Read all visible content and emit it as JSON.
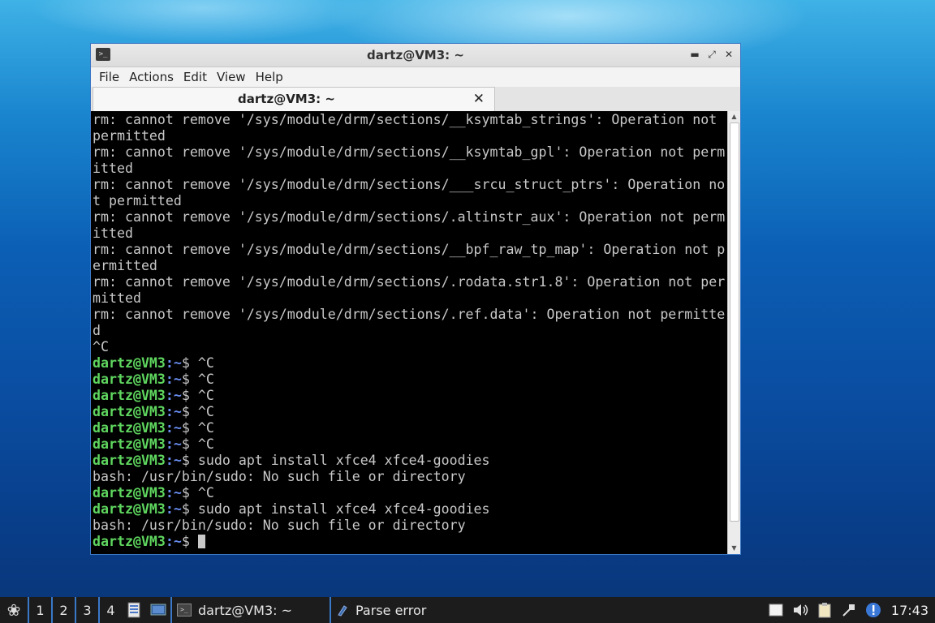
{
  "window": {
    "title": "dartz@VM3: ~",
    "menu": [
      "File",
      "Actions",
      "Edit",
      "View",
      "Help"
    ],
    "tab_label": "dartz@VM3: ~"
  },
  "terminal": {
    "lines": [
      {
        "type": "text",
        "text": "rm: cannot remove '/sys/module/drm/sections/__ksymtab_strings': Operation not"
      },
      {
        "type": "text",
        "text": "permitted"
      },
      {
        "type": "text",
        "text": "rm: cannot remove '/sys/module/drm/sections/__ksymtab_gpl': Operation not perm"
      },
      {
        "type": "text",
        "text": "itted"
      },
      {
        "type": "text",
        "text": "rm: cannot remove '/sys/module/drm/sections/___srcu_struct_ptrs': Operation no"
      },
      {
        "type": "text",
        "text": "t permitted"
      },
      {
        "type": "text",
        "text": "rm: cannot remove '/sys/module/drm/sections/.altinstr_aux': Operation not perm"
      },
      {
        "type": "text",
        "text": "itted"
      },
      {
        "type": "text",
        "text": "rm: cannot remove '/sys/module/drm/sections/__bpf_raw_tp_map': Operation not p"
      },
      {
        "type": "text",
        "text": "ermitted"
      },
      {
        "type": "text",
        "text": "rm: cannot remove '/sys/module/drm/sections/.rodata.str1.8': Operation not per"
      },
      {
        "type": "text",
        "text": "mitted"
      },
      {
        "type": "text",
        "text": "rm: cannot remove '/sys/module/drm/sections/.ref.data': Operation not permitte"
      },
      {
        "type": "text",
        "text": "d"
      },
      {
        "type": "text",
        "text": "^C"
      },
      {
        "type": "prompt",
        "user": "dartz@VM3",
        "path": ":~",
        "sym": "$ ",
        "cmd": "^C"
      },
      {
        "type": "prompt",
        "user": "dartz@VM3",
        "path": ":~",
        "sym": "$ ",
        "cmd": "^C"
      },
      {
        "type": "prompt",
        "user": "dartz@VM3",
        "path": ":~",
        "sym": "$ ",
        "cmd": "^C"
      },
      {
        "type": "prompt",
        "user": "dartz@VM3",
        "path": ":~",
        "sym": "$ ",
        "cmd": "^C"
      },
      {
        "type": "prompt",
        "user": "dartz@VM3",
        "path": ":~",
        "sym": "$ ",
        "cmd": "^C"
      },
      {
        "type": "prompt",
        "user": "dartz@VM3",
        "path": ":~",
        "sym": "$ ",
        "cmd": "^C"
      },
      {
        "type": "prompt",
        "user": "dartz@VM3",
        "path": ":~",
        "sym": "$ ",
        "cmd": "sudo apt install xfce4 xfce4-goodies"
      },
      {
        "type": "text",
        "text": "bash: /usr/bin/sudo: No such file or directory"
      },
      {
        "type": "prompt",
        "user": "dartz@VM3",
        "path": ":~",
        "sym": "$ ",
        "cmd": "^C"
      },
      {
        "type": "prompt",
        "user": "dartz@VM3",
        "path": ":~",
        "sym": "$ ",
        "cmd": "sudo apt install xfce4 xfce4-goodies"
      },
      {
        "type": "text",
        "text": "bash: /usr/bin/sudo: No such file or directory"
      },
      {
        "type": "prompt",
        "user": "dartz@VM3",
        "path": ":~",
        "sym": "$ ",
        "cmd": "",
        "cursor": true
      }
    ]
  },
  "taskbar": {
    "workspaces": [
      "1",
      "2",
      "3",
      "4"
    ],
    "tasks": [
      {
        "label": "dartz@VM3: ~",
        "icon": "terminal-icon"
      },
      {
        "label": "Parse error",
        "icon": "document-icon"
      }
    ],
    "clock": "17:43",
    "tray_icons": [
      "notes-icon",
      "volume-icon",
      "clipboard-icon",
      "network-icon",
      "updates-icon"
    ]
  }
}
